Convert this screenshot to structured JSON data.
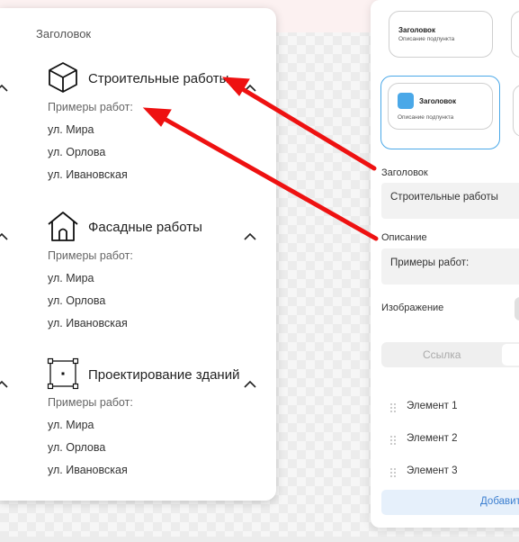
{
  "preview": {
    "title": "Заголовок",
    "sections": [
      {
        "title": "Строительные работы",
        "icon": "box-3d-icon",
        "lines": [
          "Примеры работ:",
          "ул. Мира",
          "ул. Орлова",
          "ул. Ивановская"
        ]
      },
      {
        "title": "Фасадные работы",
        "icon": "house-icon",
        "lines": [
          "Примеры работ:",
          "ул. Мира",
          "ул. Орлова",
          "ул. Ивановская"
        ]
      },
      {
        "title": "Проектирование зданий",
        "icon": "selection-frame-icon",
        "lines": [
          "Примеры работ:",
          "ул. Мира",
          "ул. Орлова",
          "ул. Ивановская"
        ]
      }
    ]
  },
  "panel": {
    "templates": [
      {
        "title": "Заголовок",
        "subtitle": "Описание подпункта"
      },
      {
        "title": "Заголовок",
        "subtitle": "Описание подпункта"
      }
    ],
    "heading_label": "Заголовок",
    "heading_value": "Строительные работы",
    "description_label": "Описание",
    "description_value": "Примеры работ:",
    "image_label": "Изображение",
    "tab_link": "Ссылка",
    "items": [
      "Элемент 1",
      "Элемент 2",
      "Элемент 3"
    ],
    "add_button": "Добавить"
  },
  "colors": {
    "accent": "#4aa8e8",
    "arrow": "#ee1111",
    "button_text": "#3c7fd0"
  }
}
